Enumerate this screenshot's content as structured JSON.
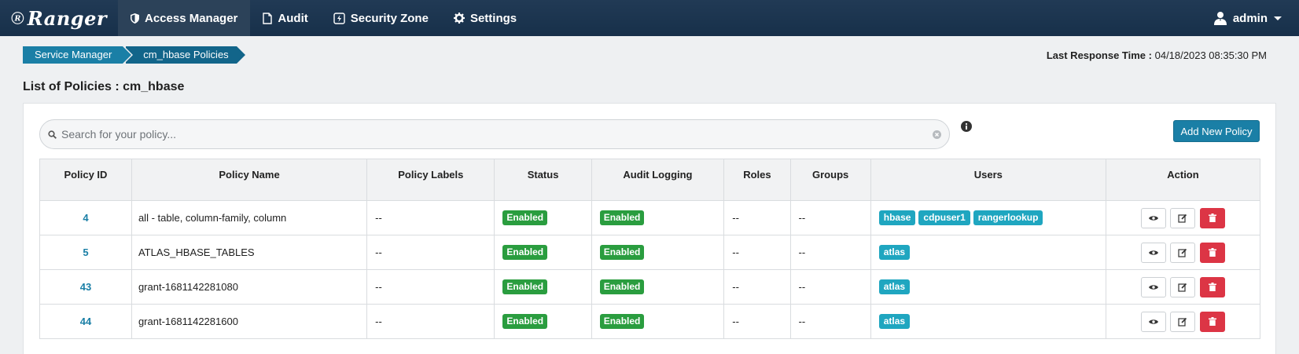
{
  "brand": {
    "name": "Ranger"
  },
  "nav": {
    "items": [
      {
        "label": "Access Manager",
        "icon": "shield-icon"
      },
      {
        "label": "Audit",
        "icon": "file-icon"
      },
      {
        "label": "Security Zone",
        "icon": "zone-icon"
      },
      {
        "label": "Settings",
        "icon": "gear-icon"
      }
    ],
    "user": "admin"
  },
  "breadcrumb": [
    "Service Manager",
    "cm_hbase Policies"
  ],
  "response_time": {
    "label": "Last Response Time :",
    "value": "04/18/2023 08:35:30 PM"
  },
  "page_title": "List of Policies : cm_hbase",
  "search": {
    "placeholder": "Search for your policy...",
    "value": ""
  },
  "add_button": "Add New Policy",
  "table": {
    "headers": [
      "Policy ID",
      "Policy Name",
      "Policy Labels",
      "Status",
      "Audit Logging",
      "Roles",
      "Groups",
      "Users",
      "Action"
    ],
    "rows": [
      {
        "id": "4",
        "name": "all - table, column-family, column",
        "labels": "--",
        "status": "Enabled",
        "audit": "Enabled",
        "roles": "--",
        "groups": "--",
        "users": [
          "hbase",
          "cdpuser1",
          "rangerlookup"
        ]
      },
      {
        "id": "5",
        "name": "ATLAS_HBASE_TABLES",
        "labels": "--",
        "status": "Enabled",
        "audit": "Enabled",
        "roles": "--",
        "groups": "--",
        "users": [
          "atlas"
        ]
      },
      {
        "id": "43",
        "name": "grant-1681142281080",
        "labels": "--",
        "status": "Enabled",
        "audit": "Enabled",
        "roles": "--",
        "groups": "--",
        "users": [
          "atlas"
        ]
      },
      {
        "id": "44",
        "name": "grant-1681142281600",
        "labels": "--",
        "status": "Enabled",
        "audit": "Enabled",
        "roles": "--",
        "groups": "--",
        "users": [
          "atlas"
        ]
      }
    ]
  },
  "colors": {
    "navbar": "#17304a",
    "accent": "#1a7fa6",
    "enabled": "#2a9d3f",
    "user_badge": "#1fa6c0",
    "delete": "#dc3545"
  }
}
